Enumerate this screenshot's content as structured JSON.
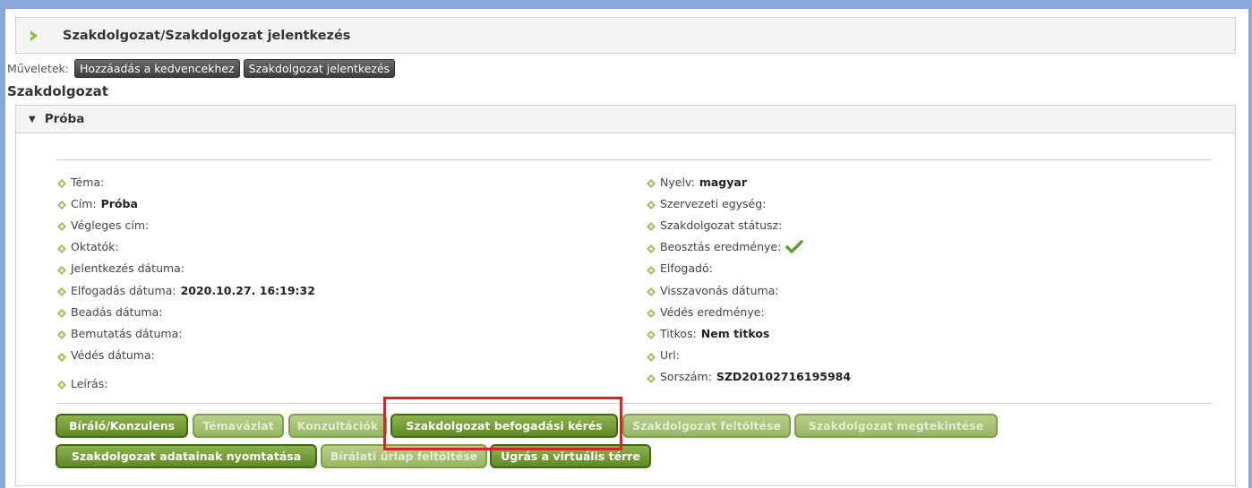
{
  "header": {
    "title": "Szakdolgozat/Szakdolgozat jelentkezés"
  },
  "actions": {
    "label": "Műveletek:",
    "buttons": [
      "Hozzáadás a kedvencekhez",
      "Szakdolgozat jelentkezés"
    ]
  },
  "section_title": "Szakdolgozat",
  "panel": {
    "title": "Próba"
  },
  "left_fields": [
    {
      "label": "Téma:",
      "value": ""
    },
    {
      "label": "Cím:",
      "value": "Próba"
    },
    {
      "label": "Végleges cím:",
      "value": ""
    },
    {
      "label": "Oktatók:",
      "value": ""
    },
    {
      "label": "Jelentkezés dátuma:",
      "value": ""
    },
    {
      "label": "Elfogadás dátuma:",
      "value": "2020.10.27. 16:19:32"
    },
    {
      "label": "Beadás dátuma:",
      "value": ""
    },
    {
      "label": "Bemutatás dátuma:",
      "value": ""
    },
    {
      "label": "Védés dátuma:",
      "value": ""
    }
  ],
  "leiras_label": "Leírás:",
  "right_fields": [
    {
      "label": "Nyelv:",
      "value": "magyar"
    },
    {
      "label": "Szervezeti egység:",
      "value": ""
    },
    {
      "label": "Szakdolgozat státusz:",
      "value": ""
    },
    {
      "label": "Beosztás eredménye:",
      "value": ""
    },
    {
      "label": "Elfogadó:",
      "value": ""
    },
    {
      "label": "Visszavonás dátuma:",
      "value": ""
    },
    {
      "label": "Védés eredménye:",
      "value": ""
    },
    {
      "label": "Titkos:",
      "value": "Nem titkos"
    },
    {
      "label": "Url:",
      "value": ""
    },
    {
      "label": "Sorszám:",
      "value": "SZD20102716195984"
    }
  ],
  "buttons": {
    "biralo": "Bíráló/Konzulens",
    "temavazlat": "Témavázlat",
    "konzultaciok": "Konzultációk",
    "befogadasi": "Szakdolgozat befogadási kérés",
    "feltoltese": "Szakdolgozat feltöltése",
    "megtekintese": "Szakdolgozat megtekintése",
    "nyomtatasa": "Szakdolgozat adatainak nyomtatása",
    "biralati": "Bírálati űrlap feltöltése",
    "virtualis": "Ugrás a virtuális térre"
  },
  "colors": {
    "frame": "#8aa9d8",
    "button_green": "#6e9a2e",
    "highlight_red": "#d9232a"
  },
  "icons": {
    "header_arrow": "chevron-right-icon",
    "bullet": "diamond-bullet-icon",
    "status": "checkmark-icon"
  }
}
